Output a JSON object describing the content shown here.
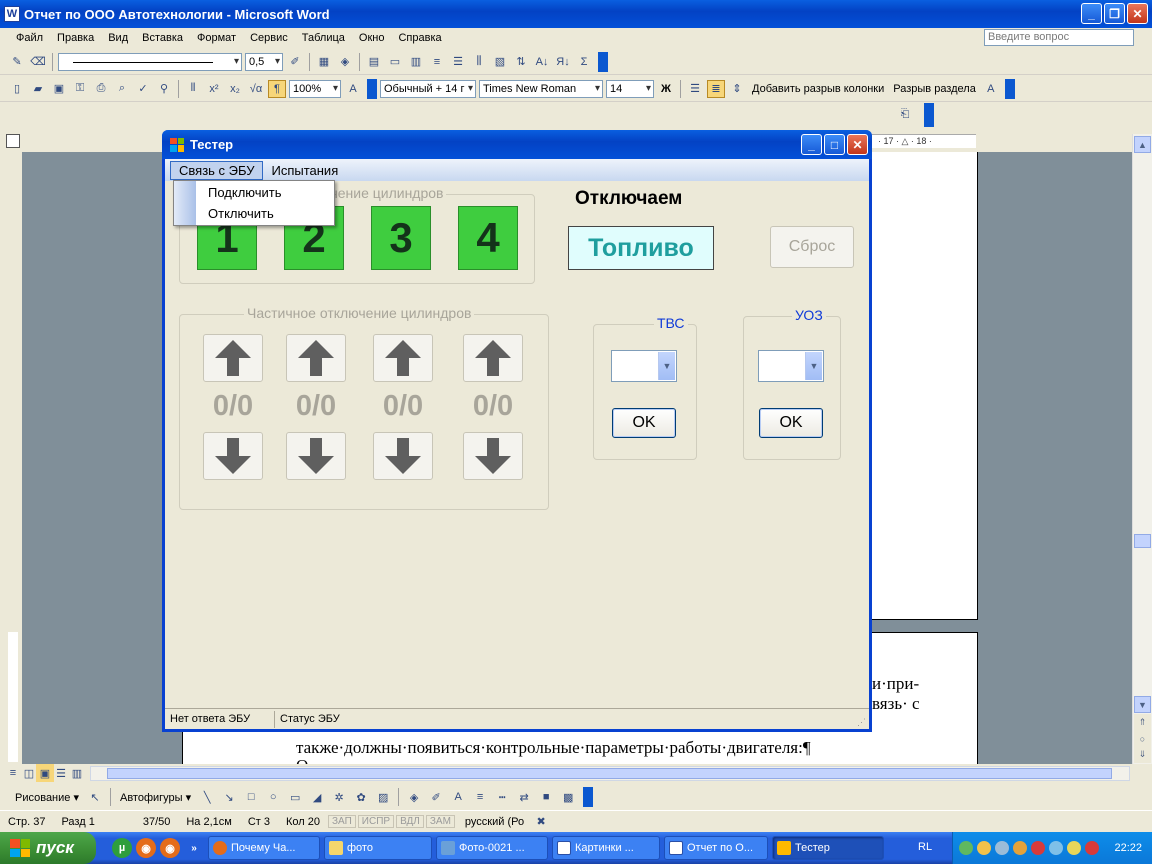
{
  "word": {
    "title": "Отчет по ООО Автотехнологии - Microsoft Word",
    "menu": [
      "Файл",
      "Правка",
      "Вид",
      "Вставка",
      "Формат",
      "Сервис",
      "Таблица",
      "Окно",
      "Справка"
    ],
    "help_placeholder": "Введите вопрос",
    "toolbar1": {
      "line_weight": "0,5"
    },
    "toolbar2": {
      "zoom": "100%",
      "style": "Обычный + 14 г",
      "font": "Times New Roman",
      "size": "14",
      "bold": "Ж",
      "insert_column_break": "Добавить разрыв колонки",
      "section_break": "Разрыв раздела"
    },
    "ruler_text": "· 17 · △ · 18 ·",
    "doc_lines": [
      "и·при-",
      "вязь· с",
      "также·должны·появиться·контрольные·параметры·работы·двигателя:¶",
      "О"
    ],
    "drawbar": {
      "drawing": "Рисование ▾",
      "autoshapes": "Автофигуры ▾"
    },
    "status": {
      "page": "Стр. 37",
      "section": "Разд 1",
      "pages": "37/50",
      "at": "На 2,1см",
      "line": "Ст 3",
      "col": "Кол 20",
      "rec": "ЗАП",
      "trk": "ИСПР",
      "ext": "ВДЛ",
      "ovr": "ЗАМ",
      "lang": "русский (Ро"
    }
  },
  "tester": {
    "title": "Тестер",
    "menu": {
      "ecu": "Связь с ЭБУ",
      "tests": "Испытания"
    },
    "ecu_menu": {
      "connect": "Подключить",
      "disconnect": "Отключить"
    },
    "full_group": "Полное отключение цилиндров",
    "cylinders": [
      "1",
      "2",
      "3",
      "4"
    ],
    "turning_off_label": "Отключаем",
    "fuel_label": "Топливо",
    "reset_label": "Сброс",
    "partial_group": "Частичное отключение цилиндров",
    "ratios": [
      "0/0",
      "0/0",
      "0/0",
      "0/0"
    ],
    "tvs": {
      "legend": "ТВС",
      "ok": "OK"
    },
    "uoz": {
      "legend": "УОЗ",
      "ok": "OK"
    },
    "status": {
      "ecu_response": "Нет ответа ЭБУ",
      "ecu_status": "Статус ЭБУ"
    }
  },
  "taskbar": {
    "start": "пуск",
    "tasks": [
      "Почему Ча...",
      "фото",
      "Фото-0021 ...",
      "Картинки ...",
      "Отчет по О...",
      "Тестер"
    ],
    "lang": "RL",
    "clock": "22:22"
  },
  "colors": {
    "xp_blue": "#0342c4",
    "cylinder_green": "#3fcd3f",
    "fuel_teal": "#1f9e9e",
    "legend_blue": "#0f3ad8"
  }
}
